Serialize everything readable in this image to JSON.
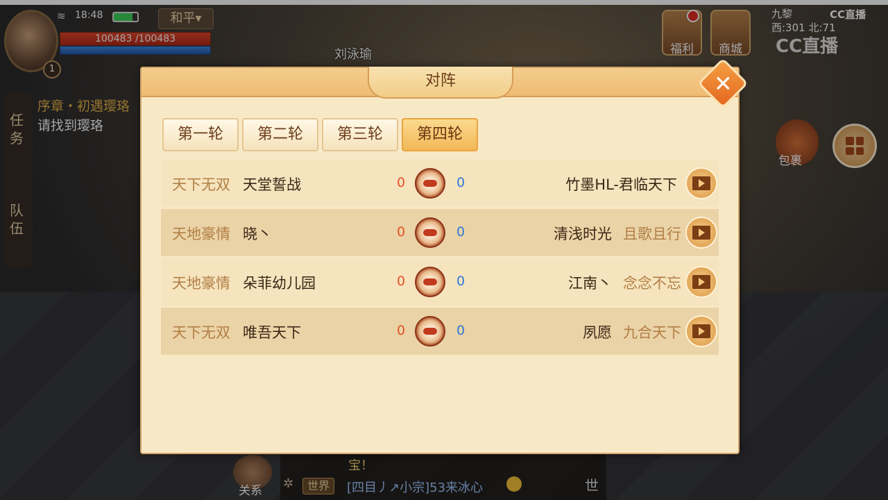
{
  "hud": {
    "time": "18:48",
    "mode": "和平▾",
    "hp": "100483 /100483",
    "level": "1",
    "quest_tab_task": "任\n务",
    "quest_tab_team": "队\n伍",
    "quest_title": "序章・初遇璎珞",
    "quest_desc": "请找到璎珞",
    "top_npc_name": "刘泳瑜",
    "welfare": "福利",
    "shop": "商城",
    "coord_line1": "九黎",
    "coord_line2": "西:301 北:71",
    "bag": "包裹",
    "cc_small": "CC直播",
    "cc_big": "CC直播"
  },
  "chat": {
    "line1": "宝！",
    "world_tag": "世界",
    "line2": "[四目丿↗小宗]53来冰心",
    "relation": "关系",
    "voice": "世"
  },
  "dialog": {
    "title": "对阵",
    "tabs": [
      "第一轮",
      "第二轮",
      "第三轮",
      "第四轮"
    ],
    "active_tab": 3,
    "matches": [
      {
        "left_guild": "天下无双",
        "left_team": "天堂誓战",
        "left_score": "0",
        "right_score": "0",
        "right_team": "竹墨HL-君临天下",
        "right_guild": ""
      },
      {
        "left_guild": "天地豪情",
        "left_team": "晓丶",
        "left_score": "0",
        "right_score": "0",
        "right_team": "清浅时光",
        "right_guild": "且歌且行"
      },
      {
        "left_guild": "天地豪情",
        "left_team": "朵菲幼儿园",
        "left_score": "0",
        "right_score": "0",
        "right_team": "江南丶",
        "right_guild": "念念不忘"
      },
      {
        "left_guild": "天下无双",
        "left_team": "唯吾天下",
        "left_score": "0",
        "right_score": "0",
        "right_team": "夙愿",
        "right_guild": "九合天下"
      }
    ]
  }
}
